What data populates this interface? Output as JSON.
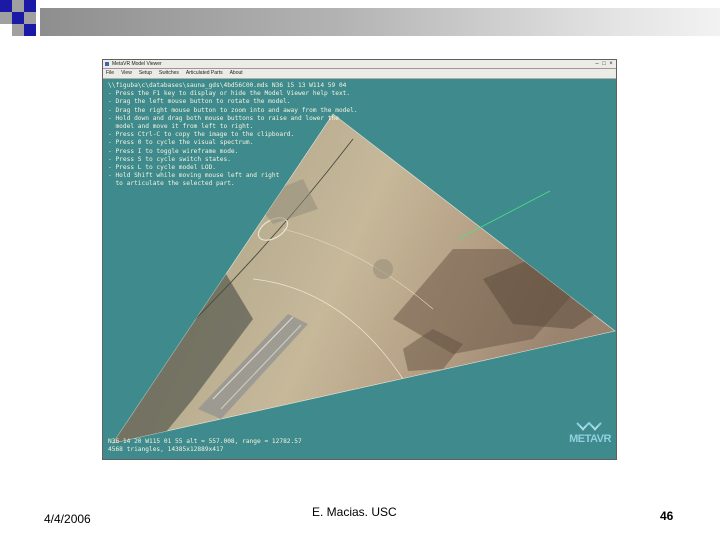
{
  "window": {
    "title": "MetaVR Model Viewer",
    "menu": [
      "File",
      "View",
      "Setup",
      "Switches",
      "Articulated Parts",
      "About"
    ]
  },
  "viewport": {
    "help_lines": [
      "\\\\figuba\\c\\databases\\sauna_gds\\4bd56C00.mds N36 15 13 W114 59 04",
      "- Press the F1 key to display or hide the Model Viewer help text.",
      "- Drag the left mouse button to rotate the model.",
      "- Drag the right mouse button to zoom into and away from the model.",
      "- Hold down and drag both mouse buttons to raise and lower the",
      "  model and move it from left to right.",
      "- Press Ctrl-C to copy the image to the clipboard.",
      "- Press 0 to cycle the visual spectrum.",
      "- Press I to toggle wireframe mode.",
      "- Press S to cycle switch states.",
      "- Press L to cycle model LOD.",
      "- Hold Shift while moving mouse left and right",
      "  to articulate the selected part."
    ],
    "status_lines": [
      "N36 14 20 W115 01 55 alt = 557.008, range = 12782.57",
      "4568 triangles, 14385x12889x417"
    ],
    "logo_text": "METAVR"
  },
  "footer": {
    "date": "4/4/2006",
    "author": "E. Macias. USC",
    "page": "46"
  },
  "colors": {
    "viewport_bg": "#3e8a8c",
    "deco_blue": "#1a1aa6",
    "deco_gray": "#a0a0a0"
  }
}
